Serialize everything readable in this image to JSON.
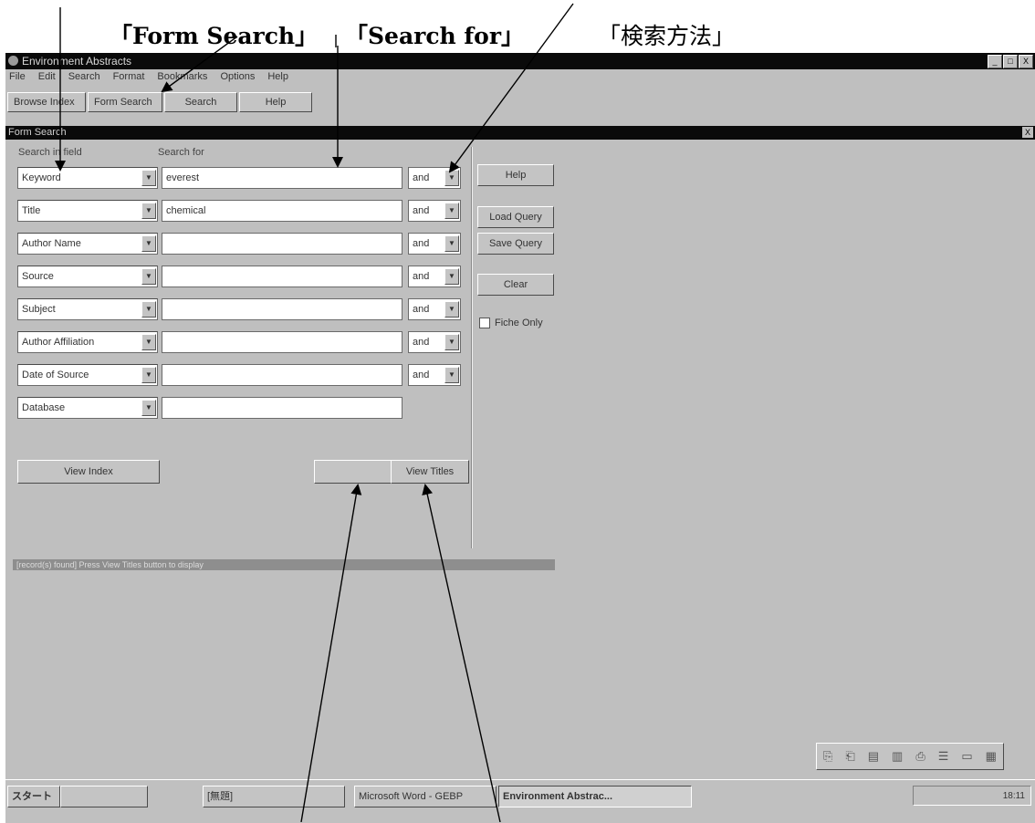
{
  "callouts": {
    "form_search": "「Form Search」",
    "search_for": "「Search for」",
    "search_method": "「検索方法」"
  },
  "window": {
    "title": "Environment Abstracts",
    "controls": [
      "_",
      "□",
      "X"
    ]
  },
  "menu": [
    "File",
    "Edit",
    "Search",
    "Format",
    "Bookmarks",
    "Options",
    "Help"
  ],
  "toolbar": {
    "browse_index": "Browse Index",
    "form_search": "Form Search",
    "search": "Search",
    "help": "Help"
  },
  "form": {
    "title": "Form Search",
    "close": "X",
    "header_field": "Search in field",
    "header_search": "Search for",
    "rows": [
      {
        "field": "Keyword",
        "value": "everest",
        "op": "and"
      },
      {
        "field": "Title",
        "value": "chemical",
        "op": "and"
      },
      {
        "field": "Author Name",
        "value": "",
        "op": "and"
      },
      {
        "field": "Source",
        "value": "",
        "op": "and"
      },
      {
        "field": "Subject",
        "value": "",
        "op": "and"
      },
      {
        "field": "Author Affiliation",
        "value": "",
        "op": "and"
      },
      {
        "field": "Date of Source",
        "value": "",
        "op": "and"
      },
      {
        "field": "Database",
        "value": "",
        "op": ""
      }
    ],
    "side": {
      "help": "Help",
      "load_query": "Load Query",
      "save_query": "Save Query",
      "clear": "Clear",
      "fiche_only": "Fiche Only"
    },
    "view_index": "View Index",
    "blank_button": "",
    "view_titles": "View Titles",
    "status": "[record(s) found] Press View Titles button to display"
  },
  "float_toolbar": [
    "⎘",
    "⎗",
    "▤",
    "▥",
    "⎙",
    "☰",
    "▭",
    "▦"
  ],
  "taskbar": {
    "start": "スタート",
    "task1": "",
    "task2": "[無題]",
    "task3": "Microsoft Word - GEBP",
    "task4": "Environment Abstrac...",
    "clock": "18:11"
  }
}
